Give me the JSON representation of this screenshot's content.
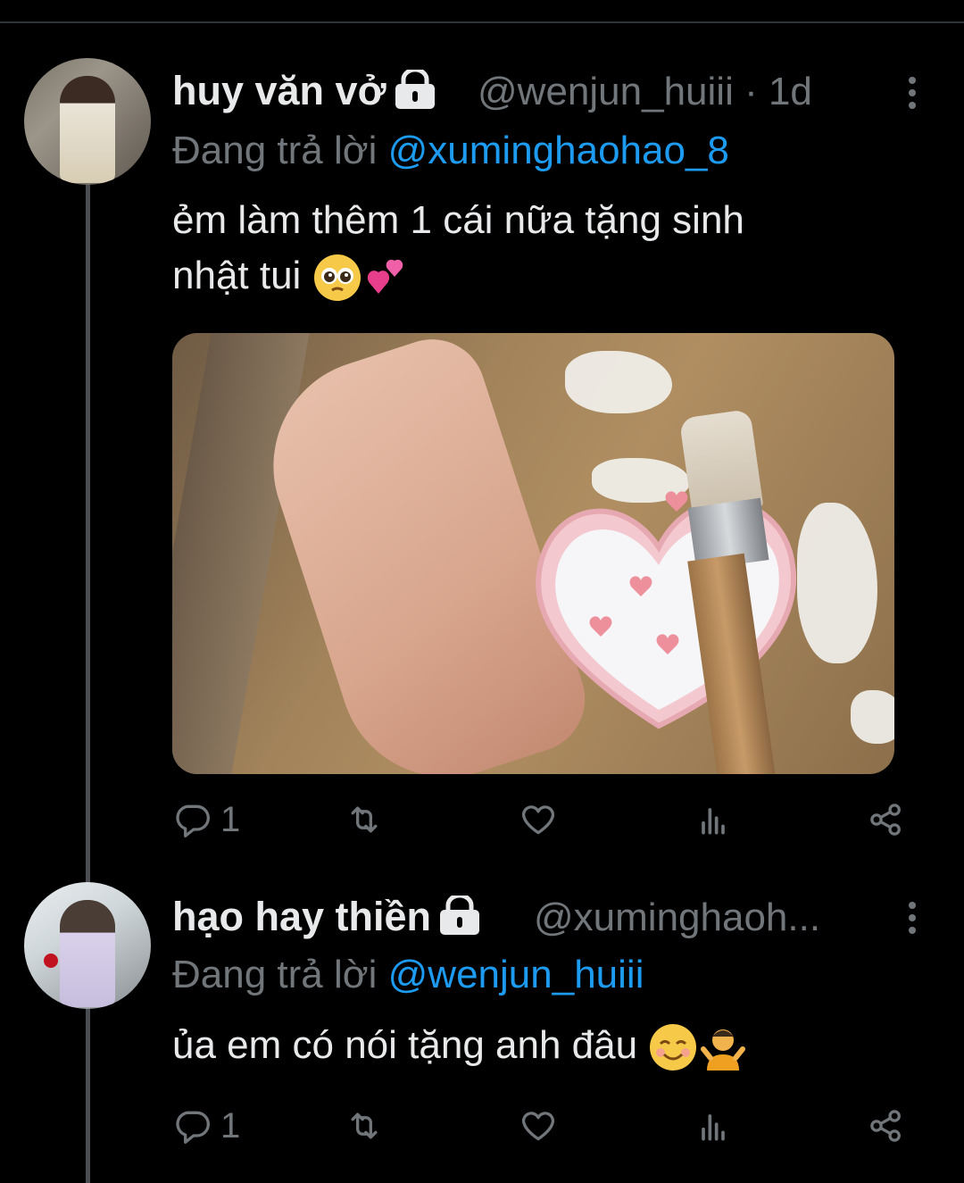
{
  "tweets": [
    {
      "display_name": "huy văn vở",
      "handle_time": "@wenjun_huiii · 1d",
      "replying_prefix": "Đang trả lời",
      "replying_to": "@xuminghaohao_8",
      "text_line1": "ẻm làm thêm 1 cái nữa tặng sinh",
      "text_line2": "nhật tui",
      "emojis": [
        "pleading-face",
        "two-hearts"
      ],
      "reply_count": "1"
    },
    {
      "display_name": "hạo hay thiền",
      "handle_time": "@xuminghaoh...",
      "replying_prefix": "Đang trả lời",
      "replying_to": "@wenjun_huiii",
      "text": "ủa em có nói tặng anh đâu",
      "emojis": [
        "smiling-face",
        "person-shrugging"
      ],
      "reply_count": "1"
    }
  ],
  "colors": {
    "background": "#000000",
    "text": "#e7e9ea",
    "secondary": "#71767b",
    "link": "#1d9bf0",
    "thread_line": "#4a4e52"
  }
}
